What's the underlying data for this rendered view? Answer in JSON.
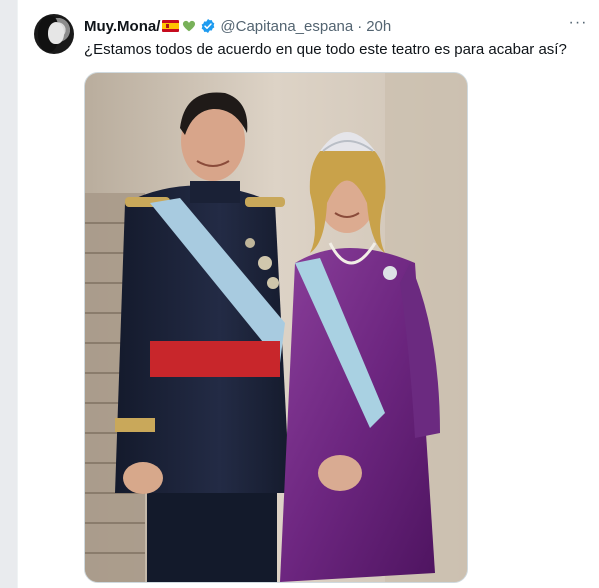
{
  "tweet": {
    "display_name": "Muy.Mona/",
    "flag_icon": "spain-flag-icon",
    "heart_icon": "green-heart-icon",
    "verified_icon": "verified-badge-icon",
    "handle": "@Capitana_espana",
    "separator": "·",
    "time": "20h",
    "more_icon": "more-options-icon",
    "more_label": "···",
    "text": "¿Estamos todos de acuerdo en que todo este teatro es para acabar así?",
    "colors": {
      "verified": "#1d9bf0",
      "heart": "#78b159",
      "text_primary": "#0f1419",
      "text_secondary": "#536471"
    }
  }
}
